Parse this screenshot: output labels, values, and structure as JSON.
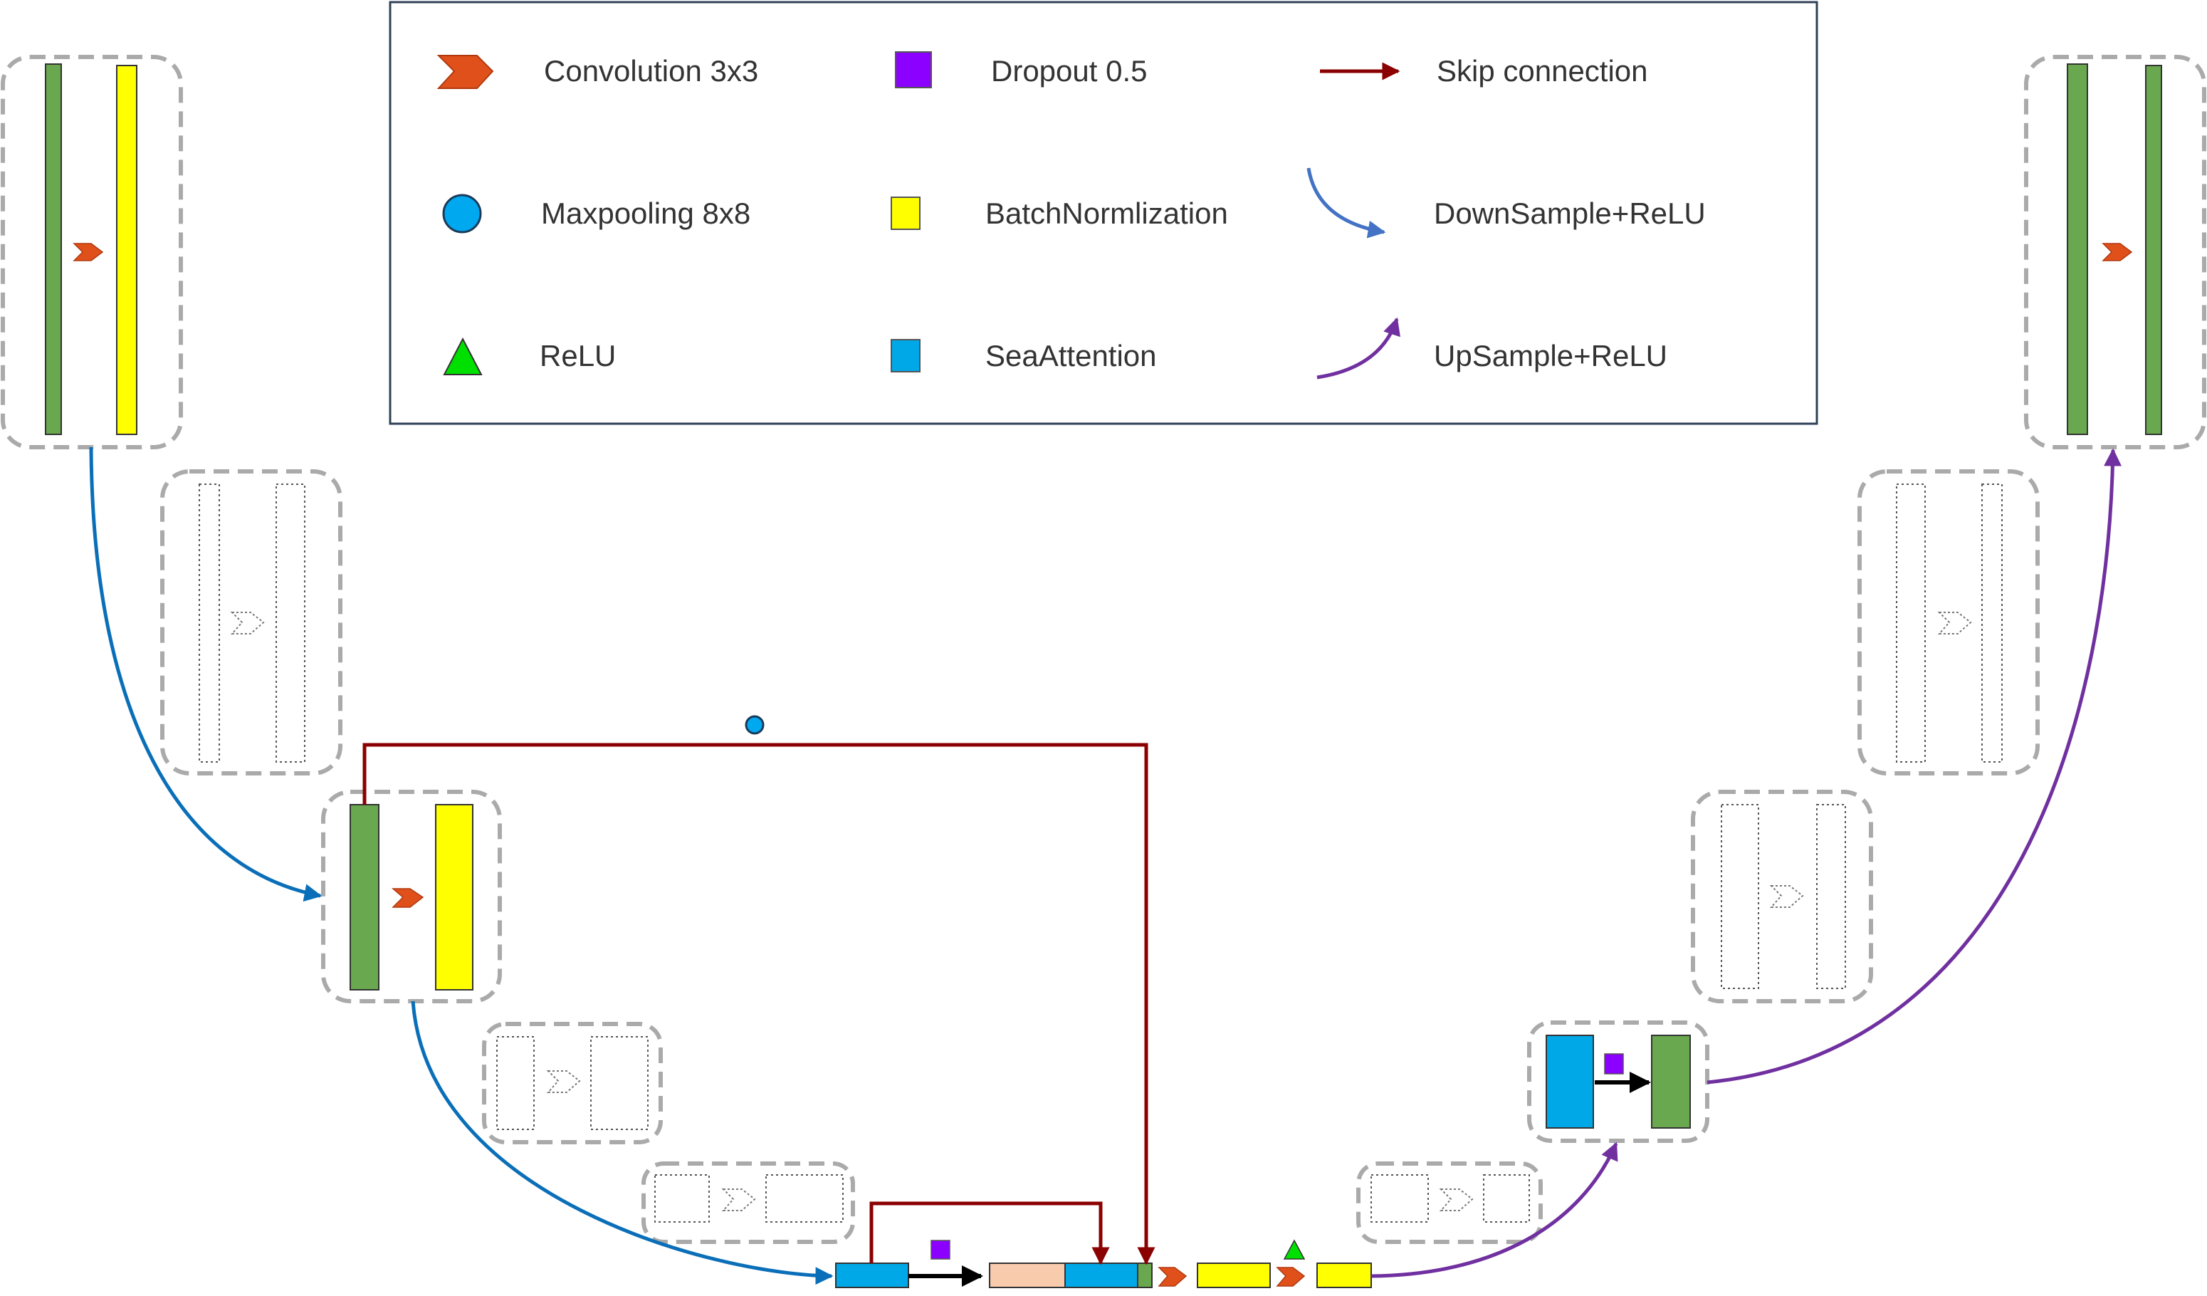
{
  "legend": {
    "items": [
      {
        "label": "Convolution 3x3",
        "icon": "convolution-chevron-icon"
      },
      {
        "label": "Dropout 0.5",
        "icon": "dropout-square-icon"
      },
      {
        "label": "Skip connection",
        "icon": "skip-connection-arrow-icon"
      },
      {
        "label": "Maxpooling 8x8",
        "icon": "maxpooling-circle-icon"
      },
      {
        "label": "BatchNormlization",
        "icon": "batchnorm-square-icon"
      },
      {
        "label": "DownSample+ReLU",
        "icon": "downsample-arrow-icon"
      },
      {
        "label": "ReLU",
        "icon": "relu-triangle-icon"
      },
      {
        "label": "SeaAttention",
        "icon": "seaattention-square-icon"
      },
      {
        "label": "UpSample+ReLU",
        "icon": "upsample-arrow-icon"
      }
    ]
  },
  "colors": {
    "convolution": "#E0501B",
    "dropout": "#8B00FF",
    "skip": "#8B0000",
    "maxpool": "#00A8F0",
    "batchnorm": "#FFFF00",
    "downsample": "#0A6FB8",
    "relu": "#00E000",
    "seaattention": "#00A8E8",
    "upsample": "#7030A0",
    "green_block": "#6AA84F",
    "peach_block": "#F8CBAD",
    "dashed_border": "#AAAAAA",
    "legend_border": "#2F4158"
  }
}
